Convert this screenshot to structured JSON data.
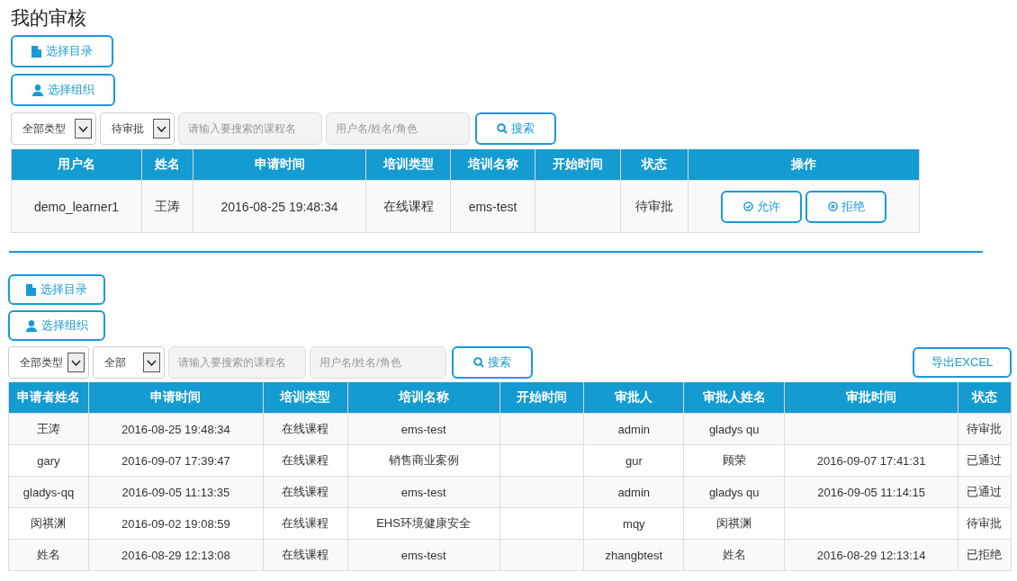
{
  "title": "我的审核",
  "sections": [
    {
      "buttons": [
        {
          "kind": "catalog",
          "label": "选择目录"
        },
        {
          "kind": "organization",
          "label": "选择组织"
        }
      ],
      "filters": {
        "type_select": "全部类型",
        "status_select": "待审批",
        "course_search": {
          "placeholder": "请输入要搜索的课程名"
        },
        "user_search": {
          "placeholder": "用户名/姓名/角色"
        },
        "search_button": "搜索"
      },
      "table": {
        "columns": [
          "用户名",
          "姓名",
          "申请时间",
          "培训类型",
          "培训名称",
          "开始时间",
          "状态",
          "操作"
        ],
        "rows": [
          {
            "cells": [
              "demo_learner1",
              "王涛",
              "2016-08-25 19:48:34",
              "在线课程",
              "ems-test",
              "",
              "待审批"
            ],
            "actions": [
              {
                "kind": "approve",
                "label": "允许"
              },
              {
                "kind": "reject",
                "label": "拒绝"
              }
            ]
          }
        ]
      }
    },
    {
      "buttons": [
        {
          "kind": "catalog",
          "label": "选择目录"
        },
        {
          "kind": "organization",
          "label": "选择组织"
        }
      ],
      "filters": {
        "type_select": "全部类型",
        "status_select": "全部",
        "course_search": {
          "placeholder": "请输入要搜索的课程名"
        },
        "user_search": {
          "placeholder": "用户名/姓名/角色"
        },
        "search_button": "搜索"
      },
      "export_button": "导出EXCEL",
      "table": {
        "columns": [
          "申请者姓名",
          "申请时间",
          "培训类型",
          "培训名称",
          "开始时间",
          "审批人",
          "审批人姓名",
          "审批时间",
          "状态"
        ],
        "rows": [
          {
            "cells": [
              "王涛",
              "2016-08-25 19:48:34",
              "在线课程",
              "ems-test",
              "",
              "admin",
              "gladys qu",
              "",
              "待审批"
            ]
          },
          {
            "cells": [
              "gary",
              "2016-09-07 17:39:47",
              "在线课程",
              "销售商业案例",
              "",
              "gur",
              "顾荣",
              "2016-09-07 17:41:31",
              "已通过"
            ]
          },
          {
            "cells": [
              "gladys-qq",
              "2016-09-05 11:13:35",
              "在线课程",
              "ems-test",
              "",
              "admin",
              "gladys qu",
              "2016-09-05 11:14:15",
              "已通过"
            ]
          },
          {
            "cells": [
              "闵祺渊",
              "2016-09-02 19:08:59",
              "在线课程",
              "EHS环境健康安全",
              "",
              "mqy",
              "闵祺渊",
              "",
              "待审批"
            ]
          },
          {
            "cells": [
              "姓名",
              "2016-08-29 12:13:08",
              "在线课程",
              "ems-test",
              "",
              "zhangbtest",
              "姓名",
              "2016-08-29 12:13:14",
              "已拒绝"
            ]
          }
        ]
      }
    }
  ]
}
